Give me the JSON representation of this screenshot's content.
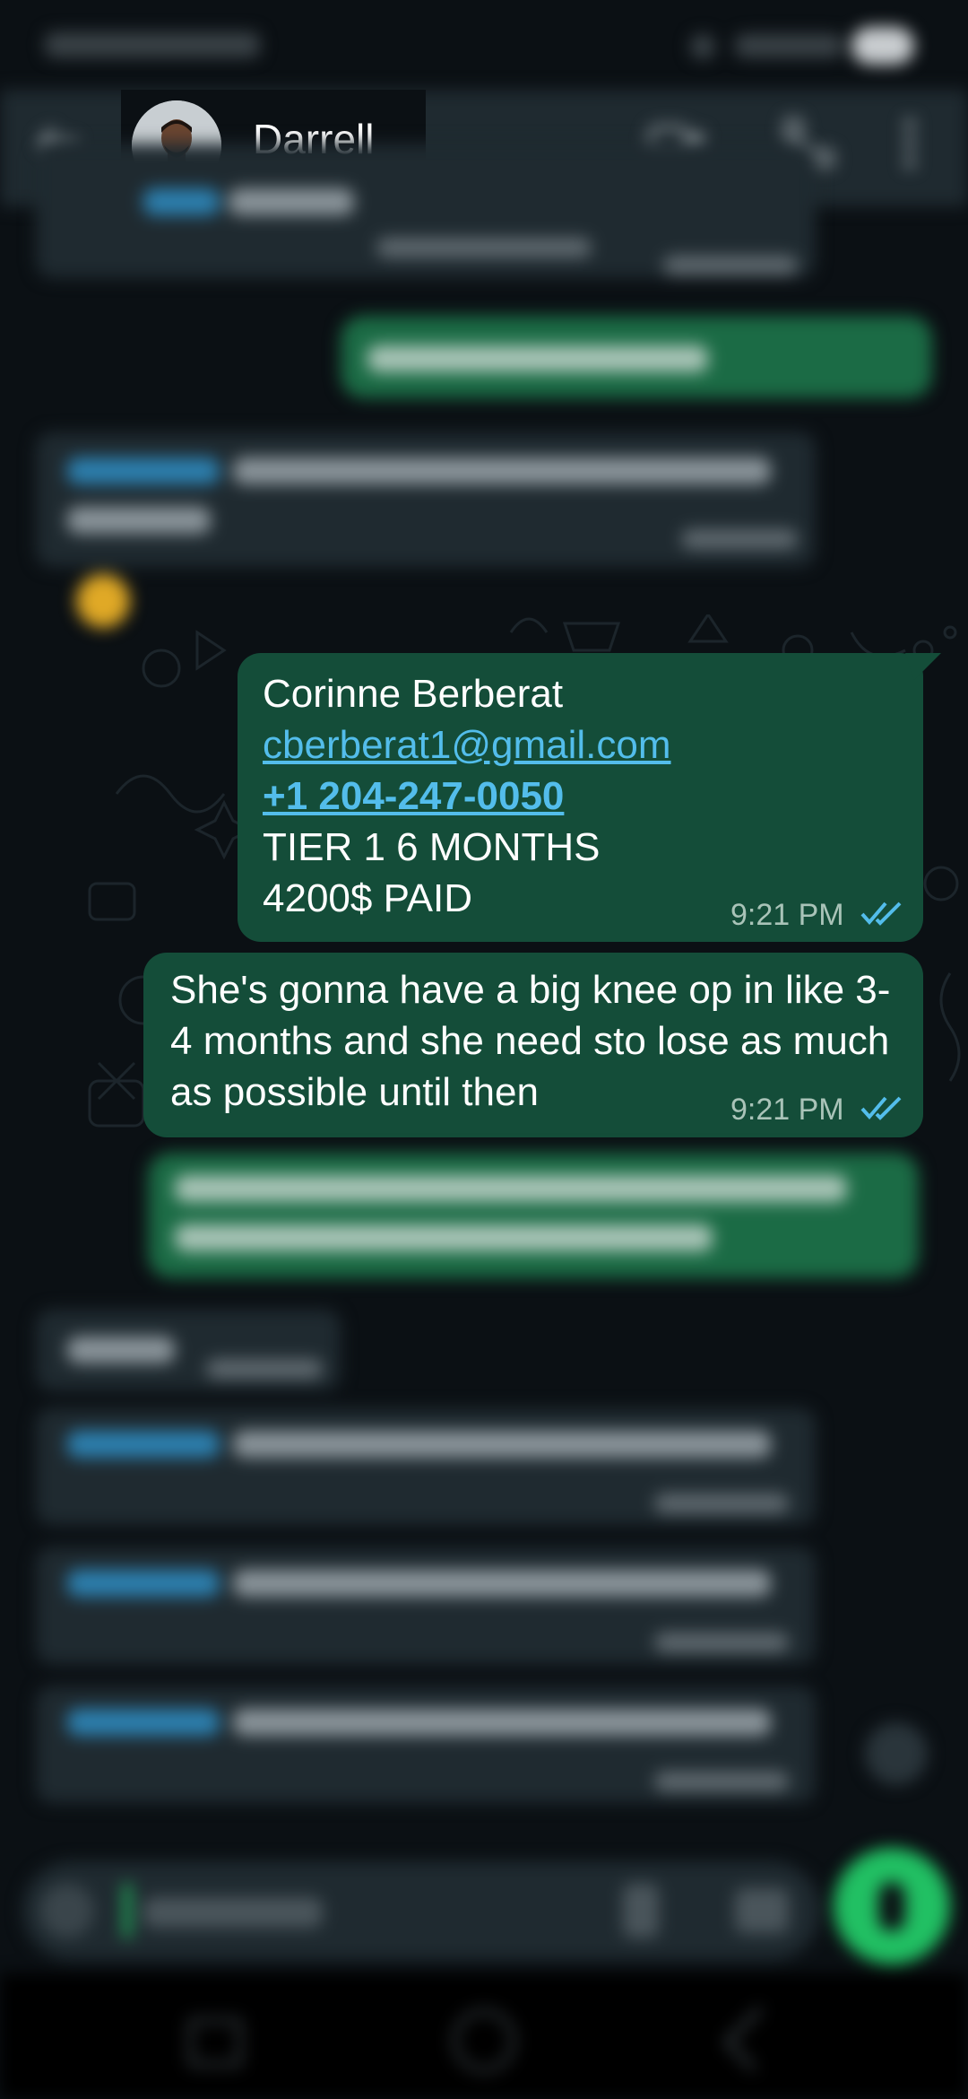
{
  "header": {
    "contact_name": "Darrell",
    "back_icon": "arrow-left-icon",
    "video_icon": "video-camera-icon",
    "call_icon": "phone-icon",
    "menu_icon": "more-vertical-icon"
  },
  "messages": {
    "contact_card": {
      "name": "Corinne Berberat",
      "email": "cberberat1@gmail.com",
      "phone": "+1 204-247-0050",
      "tier": "TIER 1 6 MONTHS",
      "paid": "4200$ PAID",
      "time": "9:21 PM",
      "status": "read"
    },
    "note": {
      "text": "She's gonna have a big knee op in like 3-4 months and she need sto lose as much as possible until then",
      "time": "9:21 PM",
      "status": "read"
    }
  },
  "colors": {
    "background": "#0b1014",
    "incoming_bubble": "#1f2a30",
    "outgoing_bubble": "#144d39",
    "link": "#53bdeb",
    "read_ticks": "#53bdeb",
    "fab": "#21c063"
  },
  "input_bar": {
    "emoji_icon": "emoji-icon",
    "attach_icon": "paperclip-icon",
    "camera_icon": "camera-icon",
    "mic_icon": "microphone-icon"
  },
  "nav": {
    "recents_icon": "recents-icon",
    "home_icon": "home-icon",
    "back_icon": "nav-back-icon"
  }
}
